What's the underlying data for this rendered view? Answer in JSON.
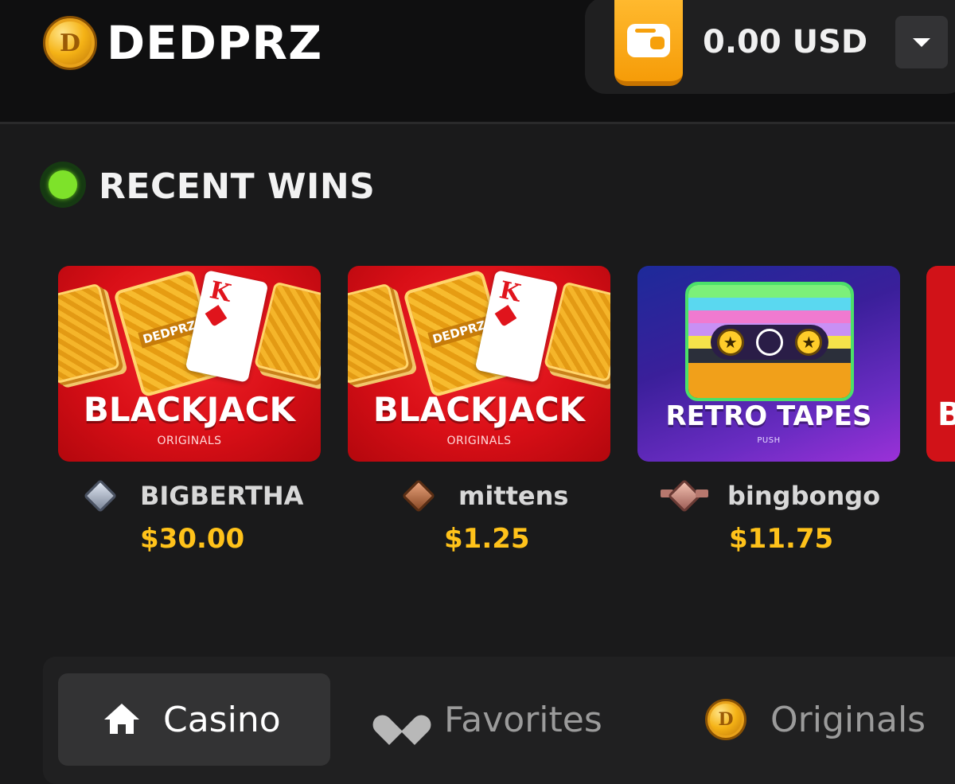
{
  "header": {
    "logo_coin_glyph": "D",
    "logo_text": "DEDPRZ",
    "balance": "0.00 USD",
    "wallet_icon": "wallet-icon",
    "dropdown_icon": "chevron-down-icon"
  },
  "recent_wins": {
    "title": "RECENT WINS",
    "status_color": "#7ee22a",
    "items": [
      {
        "game": "BLACKJACK",
        "category": "ORIGINALS",
        "card_brand": "DEDPRZ",
        "card_face": "K",
        "player": "BIGBERTHA",
        "rank_icon": "silver-rank-icon",
        "amount": "$30.00"
      },
      {
        "game": "BLACKJACK",
        "category": "ORIGINALS",
        "card_brand": "DEDPRZ",
        "card_face": "K",
        "player": "mittens",
        "rank_icon": "bronze-rank-icon",
        "amount": "$1.25"
      },
      {
        "game": "RETRO TAPES",
        "category": "PUSH",
        "player": "bingbongo",
        "rank_icon": "winged-rank-icon",
        "amount": "$11.75"
      }
    ],
    "peek_letter": "B"
  },
  "nav": {
    "tabs": [
      {
        "label": "Casino",
        "icon": "home-icon",
        "active": true
      },
      {
        "label": "Favorites",
        "icon": "heart-icon",
        "active": false
      },
      {
        "label": "Originals",
        "icon": "coin-icon",
        "active": false
      }
    ],
    "coin_glyph": "D"
  },
  "colors": {
    "background": "#1a1a1b",
    "header": "#0f0f10",
    "accent_gold": "#ffc21a",
    "wallet_orange": "#f69c08",
    "blackjack_red": "#d90f17"
  }
}
